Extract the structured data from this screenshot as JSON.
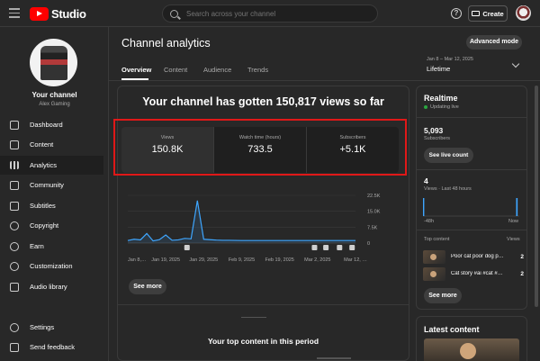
{
  "app": {
    "logo_text": "Studio",
    "brand_color": "#ff0000"
  },
  "search": {
    "placeholder": "Search across your channel"
  },
  "topbar": {
    "create_label": "Create",
    "help_glyph": "?"
  },
  "sidebar": {
    "title": "Your channel",
    "channel_name": "Alex Gaming",
    "items": [
      {
        "label": "Dashboard",
        "icon": "dashboard-icon"
      },
      {
        "label": "Content",
        "icon": "content-icon"
      },
      {
        "label": "Analytics",
        "icon": "analytics-icon",
        "active": true
      },
      {
        "label": "Community",
        "icon": "community-icon"
      },
      {
        "label": "Subtitles",
        "icon": "subtitles-icon"
      },
      {
        "label": "Copyright",
        "icon": "copyright-icon"
      },
      {
        "label": "Earn",
        "icon": "earn-icon"
      },
      {
        "label": "Customization",
        "icon": "customization-icon"
      },
      {
        "label": "Audio library",
        "icon": "audio-library-icon"
      }
    ],
    "bottom_items": [
      {
        "label": "Settings",
        "icon": "gear-icon"
      },
      {
        "label": "Send feedback",
        "icon": "feedback-icon"
      }
    ]
  },
  "header": {
    "title": "Channel analytics",
    "advanced_mode": "Advanced mode",
    "tabs": [
      "Overview",
      "Content",
      "Audience",
      "Trends"
    ],
    "date_range": "Jan 8 – Mar 12, 2025",
    "date_label": "Lifetime"
  },
  "main": {
    "headline": "Your channel has gotten 150,817 views so far",
    "metrics": [
      {
        "label": "Views",
        "value": "150.8K"
      },
      {
        "label": "Watch time (hours)",
        "value": "733.5"
      },
      {
        "label": "Subscribers",
        "value": "+5.1K"
      }
    ],
    "see_more": "See more",
    "top_content_title": "Your top content in this period"
  },
  "chart_data": {
    "type": "line",
    "x_tick_labels": [
      "Jan 8,…",
      "Jan 19, 2025",
      "Jan 29, 2025",
      "Feb 9, 2025",
      "Feb 19, 2025",
      "Mar 2, 2025",
      "Mar 12, …"
    ],
    "y_tick_labels": [
      "22.5K",
      "15.0K",
      "7.5K",
      "0"
    ],
    "ylim": [
      0,
      22500
    ],
    "series": [
      {
        "values": [
          1200,
          1800,
          1500,
          4500,
          1000,
          1600,
          3800,
          1300,
          1500,
          2200,
          2000,
          20000,
          1800,
          1600,
          1400,
          1300,
          1300,
          1250,
          1200,
          1200,
          1200,
          1200,
          1200,
          1200,
          1200,
          1200,
          1200,
          1200,
          1200,
          1200,
          1200,
          1200,
          1200,
          1200,
          1200,
          1200,
          1200
        ]
      }
    ],
    "line_color": "#3ea6ff"
  },
  "realtime": {
    "title": "Realtime",
    "status": "Updating live",
    "subscribers": "5,093",
    "subscribers_label": "Subscribers",
    "live_count_btn": "See live count",
    "views": "4",
    "views_label": "Views · Last 48 hours",
    "axis_start": "-48h",
    "axis_end": "Now",
    "mini_bars": [
      0,
      0,
      0,
      0,
      0,
      0,
      0,
      0,
      0,
      0,
      0,
      0,
      0,
      0,
      0,
      0,
      0,
      0,
      0,
      0,
      0,
      0,
      0,
      0,
      0,
      0,
      0,
      0,
      0,
      0,
      0,
      0,
      0,
      0,
      0,
      0,
      0,
      0,
      0,
      0,
      0,
      0,
      0,
      0,
      0,
      0,
      1,
      0
    ],
    "top_content_label": "Top content",
    "top_content_views_label": "Views",
    "top_content": [
      {
        "title": "Poor cat poor dog p…",
        "views": "2"
      },
      {
        "title": "Cat story #ai #cat #…",
        "views": "2"
      }
    ],
    "see_more": "See more"
  },
  "latest": {
    "title": "Latest content"
  }
}
